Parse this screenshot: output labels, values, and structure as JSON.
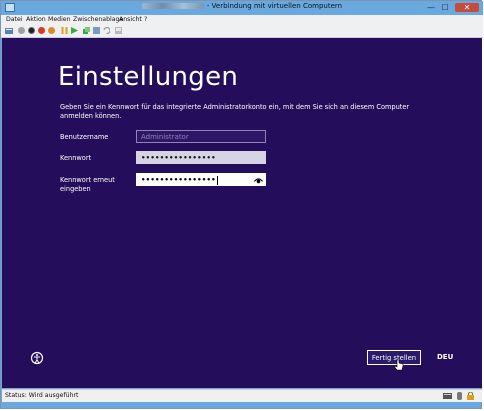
{
  "window": {
    "title": "- Verbindung mit virtuellen Computern",
    "minimize": "—",
    "maximize": "☐",
    "close": "✕"
  },
  "menu": [
    "Datei",
    "Aktion",
    "Medien",
    "Zwischenablage",
    "Ansicht",
    "?"
  ],
  "setup": {
    "heading": "Einstellungen",
    "description": "Geben Sie ein Kennwort für das integrierte Administratorkonto ein, mit dem Sie sich an diesem Computer anmelden können.",
    "username_label": "Benutzername",
    "username_value": "Administrator",
    "password_label": "Kennwort",
    "password_value": "••••••••••••••••",
    "password_repeat_label": "Kennwort erneut eingeben",
    "password_repeat_value": "••••••••••••••••",
    "finish_button": "Fertig stellen",
    "language": "DEU"
  },
  "status": {
    "text": "Status: Wird ausgeführt"
  },
  "colors": {
    "screen_bg": "#240e5c",
    "titlebar": "#6aa9e0"
  }
}
